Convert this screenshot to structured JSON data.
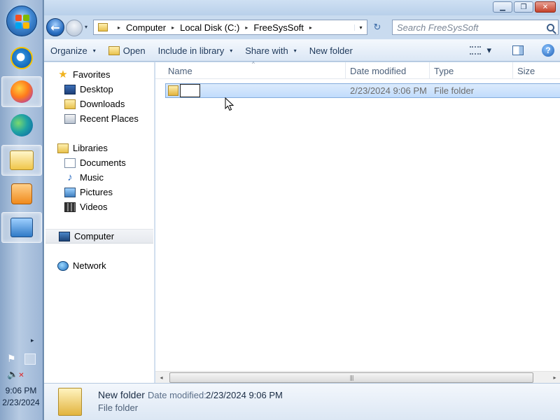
{
  "taskbar": {
    "clock_time": "9:06 PM",
    "clock_date": "2/23/2024",
    "tray_arrow": "▸",
    "tray_flag": "⚑",
    "tray_volume": "🔈",
    "tray_volume_muted": "✕",
    "icons": [
      "start-orb",
      "internet-explorer-icon",
      "firefox-icon",
      "edge-icon",
      "windows-explorer-icon",
      "media-player-icon",
      "control-panel-icon"
    ]
  },
  "window": {
    "buttons": {
      "minimize": "▁",
      "maximize": "❐",
      "close": "✕"
    }
  },
  "navigation": {
    "back_glyph": "←",
    "breadcrumbs": [
      "Computer",
      "Local Disk (C:)",
      "FreeSysSoft"
    ],
    "separator": "▸",
    "dropdown": "▾",
    "refresh_glyph": "↻",
    "search_placeholder": "Search FreeSysSoft"
  },
  "toolbar": {
    "organize": "Organize",
    "open": "Open",
    "include_in_library": "Include in library",
    "share_with": "Share with",
    "new_folder": "New folder",
    "caret": "▾",
    "help": "?"
  },
  "navpane": {
    "favorites": "Favorites",
    "desktop": "Desktop",
    "downloads": "Downloads",
    "recent_places": "Recent Places",
    "libraries": "Libraries",
    "documents": "Documents",
    "music": "Music",
    "pictures": "Pictures",
    "videos": "Videos",
    "computer": "Computer",
    "network": "Network",
    "star": "★",
    "note": "♪"
  },
  "content": {
    "columns": {
      "name": "Name",
      "date_modified": "Date modified",
      "type": "Type",
      "size": "Size"
    },
    "sort_caret": "^",
    "rows": [
      {
        "name_editing": "",
        "date_modified": "2/23/2024 9:06 PM",
        "type": "File folder"
      }
    ],
    "scroll": {
      "left": "◂",
      "right": "▸",
      "thumb_grip": "|||"
    }
  },
  "details": {
    "name": "New folder",
    "date_label": "Date modified:",
    "date_value": "2/23/2024 9:06 PM",
    "type": "File folder"
  },
  "colors": {
    "selection": "#c1dcfc",
    "selection_border": "#84acdd",
    "toolbar_text": "#1e395b",
    "close_button": "#c5422b"
  }
}
